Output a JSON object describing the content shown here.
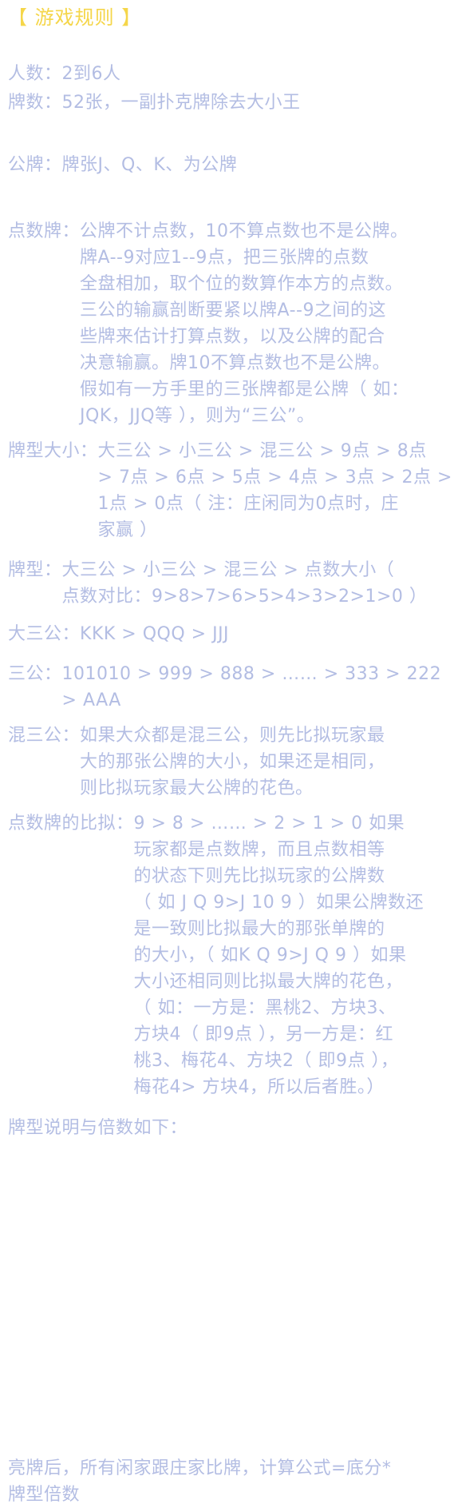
{
  "title": "【 游戏规则 】",
  "players": {
    "label": "人数：",
    "text": "2到6人"
  },
  "cards": {
    "label": "牌数：",
    "text": "52张，一副扑克牌除去大小王"
  },
  "face_cards": {
    "label": "公牌：",
    "text": "牌张J、Q、K、为公牌"
  },
  "point_cards": {
    "label": "点数牌：",
    "text": "公牌不计点数，10不算点数也不是公牌。\n牌A--9对应1--9点，把三张牌的点数\n全盘相加，取个位的数算作本方的点数。\n三公的输赢剖断要紧以牌A--9之间的这\n些牌来估计打算点数，以及公牌的配合\n决意输赢。牌10不算点数也不是公牌。\n假如有一方手里的三张牌都是公牌（ 如：\nJQK，JJQ等 ），则为“三公”。"
  },
  "hand_rank": {
    "label": "牌型大小：",
    "text": "大三公 > 小三公 > 混三公 > 9点 > 8点\n> 7点 > 6点 > 5点 > 4点 > 3点 > 2点 >\n1点 > 0点（ 注：庄闲同为0点时，庄\n家赢 ）"
  },
  "hand_type": {
    "label": "牌型：",
    "text": "大三公 > 小三公 > 混三公 > 点数大小（\n点数对比：9>8>7>6>5>4>3>2>1>0 ）"
  },
  "big_sangong": {
    "label": "大三公：",
    "text": " KKK > QQQ > JJJ"
  },
  "sangong": {
    "label": "三公：",
    "text": "101010 > 999 > 888 > …… > 333 > 222\n > AAA"
  },
  "mixed_sangong": {
    "label": "混三公：",
    "text": "如果大众都是混三公，则先比拟玩家最\n大的那张公牌的大小，如果还是相同，\n则比拟玩家最大公牌的花色。"
  },
  "point_compare": {
    "label": "点数牌的比拟：",
    "text": " 9 > 8 > …… > 2 > 1 > 0     如果\n玩家都是点数牌，而且点数相等\n的状态下则先比拟玩家的公牌数\n（ 如 J Q 9>J 10 9 ）如果公牌数还\n是一致则比拟最大的那张单牌的\n的大小，（ 如K Q 9>J Q 9 ）如果\n大小还相同则比拟最大牌的花色，\n（ 如：一方是：黑桃2、方块3、\n方块4（ 即9点 ），另一方是：红\n桃3、梅花4、方块2（ 即9点 ），\n梅花4> 方块4，所以后者胜。）"
  },
  "multiplier_header": "牌型说明与倍数如下：",
  "formula": "亮牌后，所有闲家跟庄家比牌，计算公式=底分*\n牌型倍数"
}
